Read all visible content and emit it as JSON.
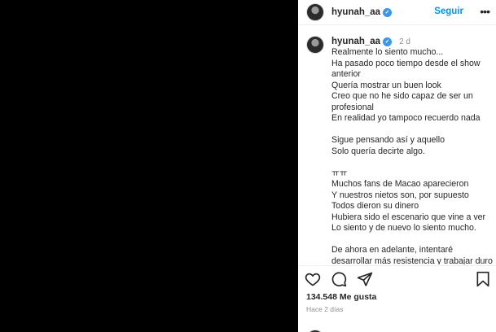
{
  "post": {
    "username": "hyunah_aa",
    "follow_label": "Seguir",
    "more_label": "•••",
    "caption_time": "2 d",
    "caption_lines": [
      "Realmente lo siento mucho...",
      "Ha pasado poco tiempo desde el show anterior",
      "Quería mostrar un buen look",
      "Creo que no he sido capaz de ser un profesional",
      "En realidad yo tampoco recuerdo nada",
      "",
      "Sigue pensando así y aquello",
      "Solo quería decirte algo.",
      "",
      "ㅠㅠ",
      "Muchos fans de Macao aparecieron",
      "Y nuestros nietos son, por supuesto",
      "Todos dieron su dinero",
      "Hubiera sido el escenario que vine a ver",
      "Lo siento y de nuevo lo siento mucho.",
      "",
      "De ahora en adelante, intentaré desarrollar más resistencia y trabajar duro de manera consistente. Estaría"
    ],
    "likes": "134.548 Me gusta",
    "time_ago": "Hace 2 días"
  },
  "icons": {
    "like": "heart-icon",
    "comment": "comment-icon",
    "share": "share-icon",
    "save": "bookmark-icon",
    "verified": "verified-icon"
  },
  "colors": {
    "link": "#0095f6",
    "verified": "#3897f0",
    "text": "#262626",
    "muted": "#8e8e8e"
  }
}
